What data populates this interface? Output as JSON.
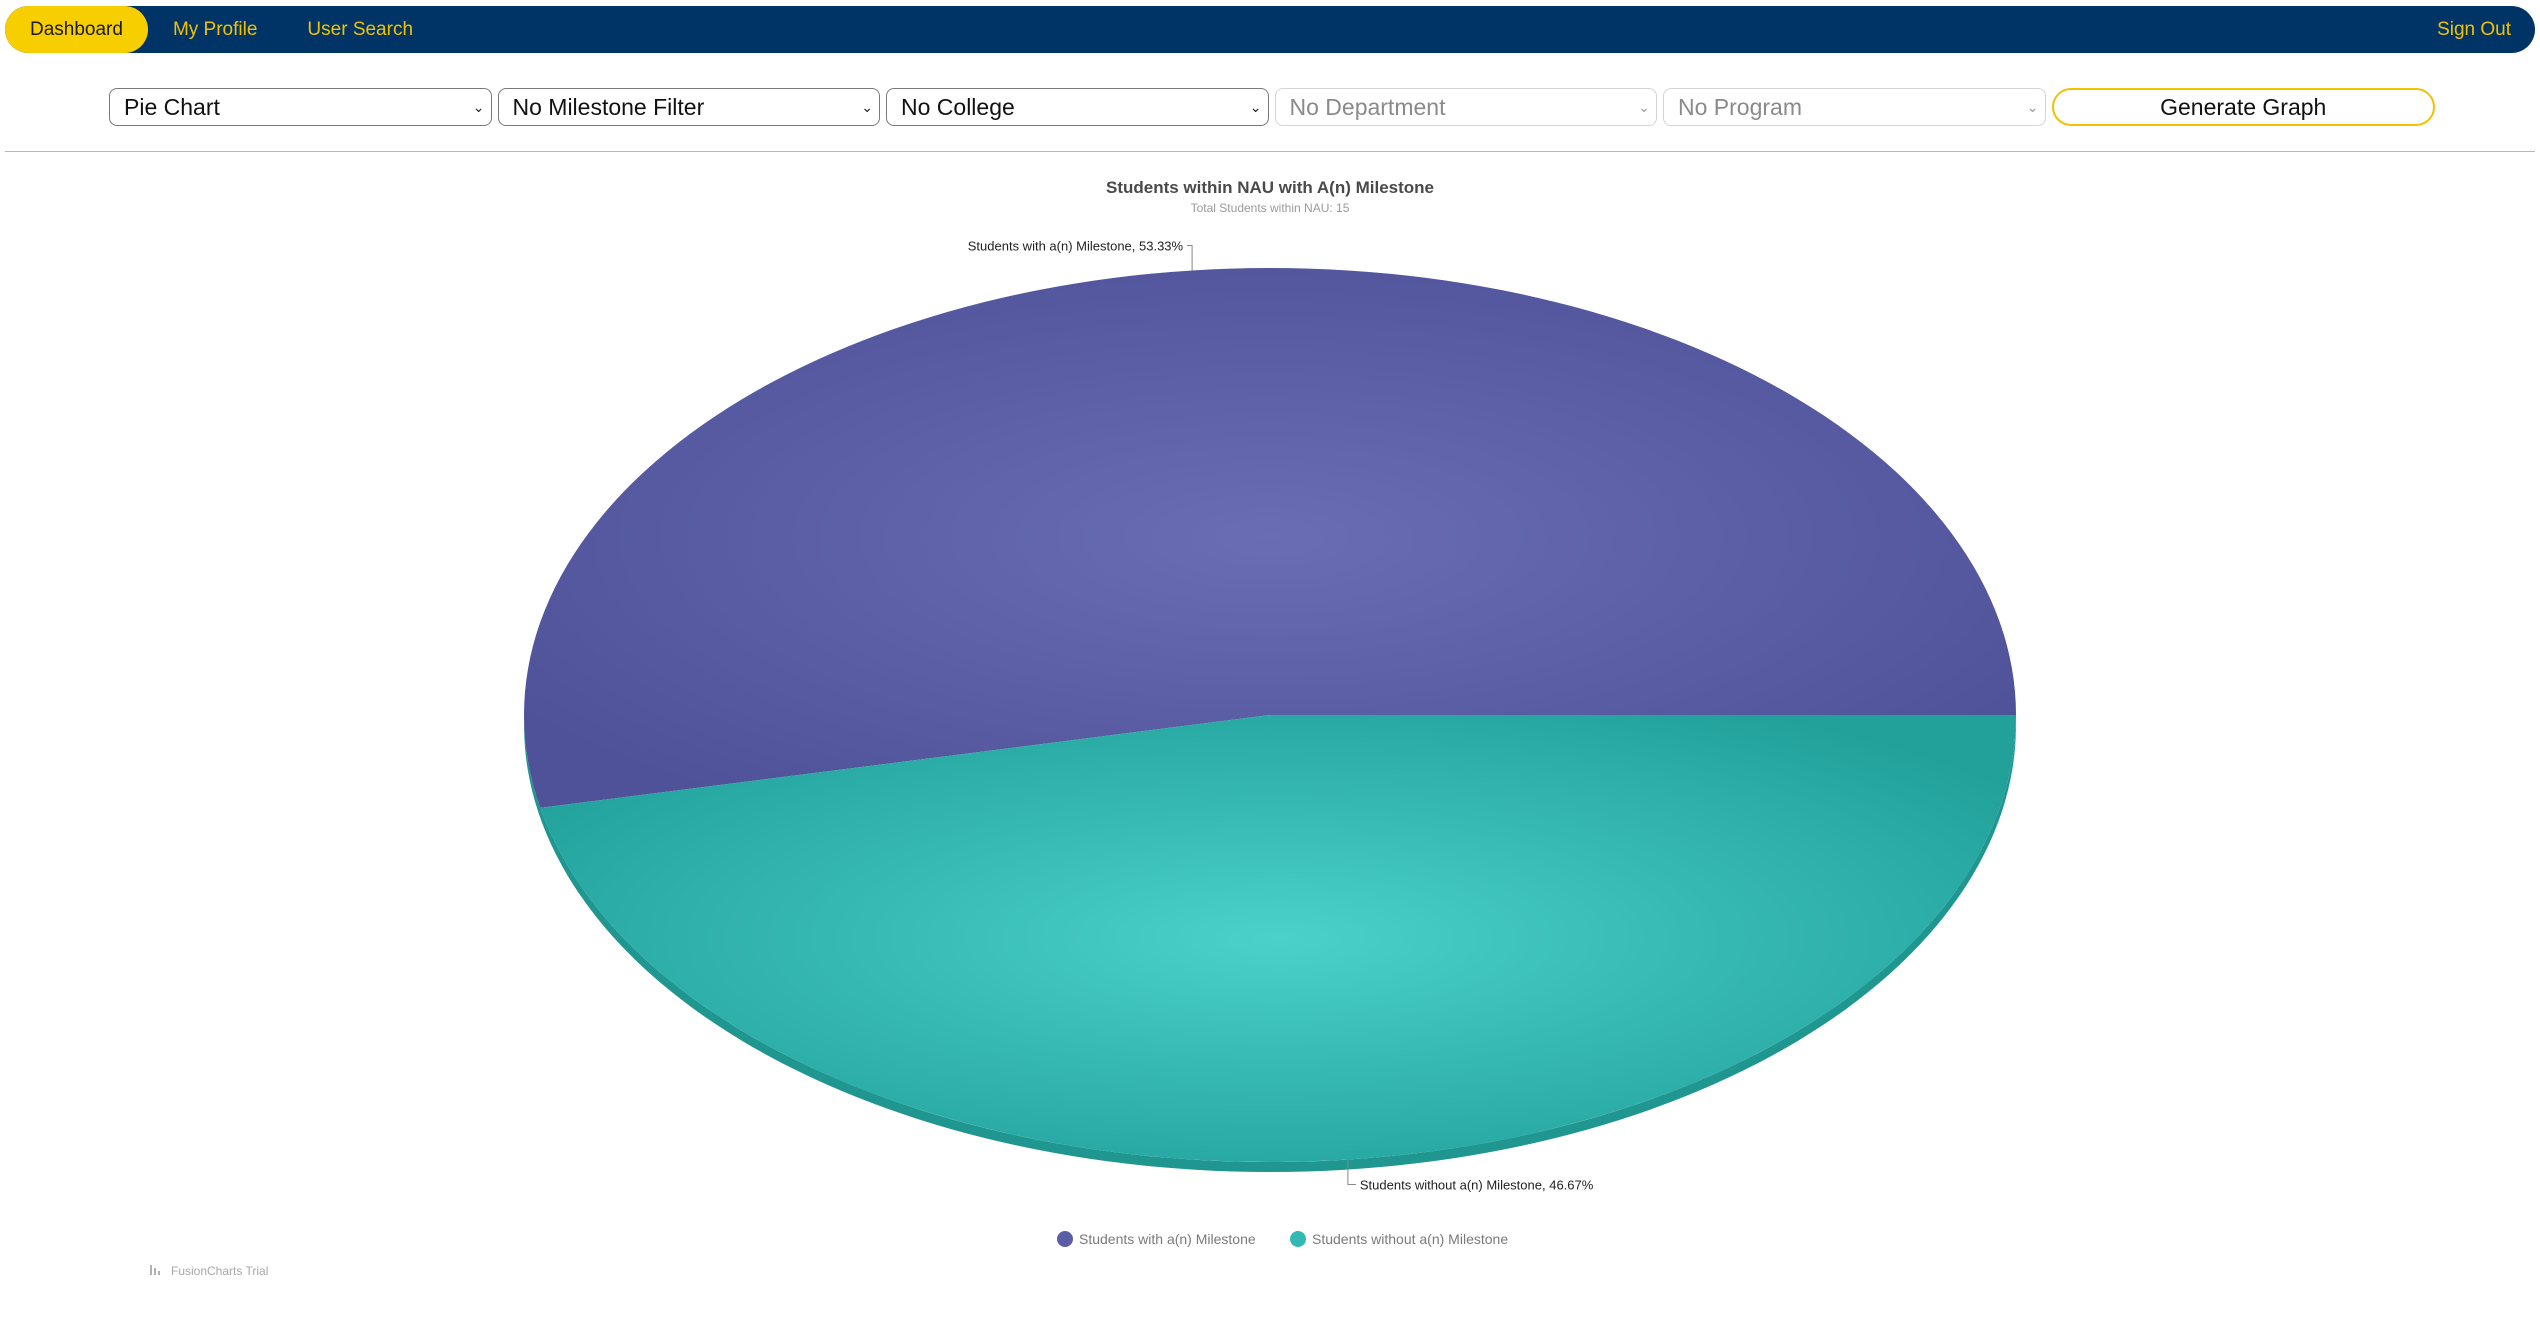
{
  "nav": {
    "dashboard": "Dashboard",
    "my_profile": "My Profile",
    "user_search": "User Search",
    "sign_out": "Sign Out"
  },
  "filters": {
    "chart_type": "Pie Chart",
    "milestone": "No Milestone Filter",
    "college": "No College",
    "department": "No Department",
    "program": "No Program",
    "generate_label": "Generate Graph"
  },
  "colors": {
    "nav_bg": "#003366",
    "nav_text": "#f2c200",
    "nav_active_bg": "#f7cf00",
    "slice_with": "#5b5ea6",
    "slice_without": "#33b9b3"
  },
  "icons": {
    "select_arrow": "chevron-down-icon",
    "trial_logo": "fusioncharts-logo-icon"
  },
  "chart_data": {
    "type": "pie",
    "title": "Students within NAU with A(n) Milestone",
    "subtitle": "Total Students within NAU: 15",
    "slices": [
      {
        "name": "Students with a(n) Milestone",
        "value": 53.33,
        "label": "Students with a(n) Milestone, 53.33%",
        "color": "#5b5ea6"
      },
      {
        "name": "Students without a(n) Milestone",
        "value": 46.67,
        "label": "Students without a(n) Milestone, 46.67%",
        "color": "#33b9b3"
      }
    ],
    "legend": [
      "Students with a(n) Milestone",
      "Students without a(n) Milestone"
    ],
    "legend_placement": "bottom-center",
    "trial_text": "FusionCharts Trial"
  }
}
